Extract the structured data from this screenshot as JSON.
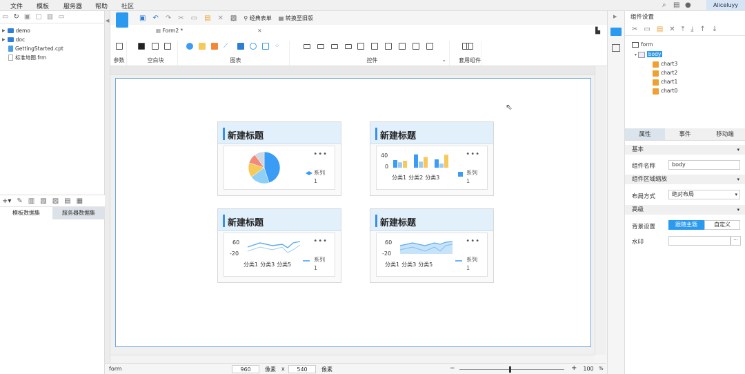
{
  "menu": {
    "file": "文件",
    "template": "模板",
    "server": "服务器",
    "help": "帮助",
    "community": "社区",
    "user": "Aliceluyy"
  },
  "left": {
    "tree": [
      {
        "label": "demo",
        "type": "folder"
      },
      {
        "label": "doc",
        "type": "folder"
      },
      {
        "label": "GettingStarted.cpt",
        "type": "file"
      },
      {
        "label": "标准地图.frm",
        "type": "map"
      }
    ],
    "ds_tab1": "模板数据集",
    "ds_tab2": "服务器数据集"
  },
  "toolbar": {
    "classic_form": "经典表单",
    "convert_old": "转换至旧版",
    "doc_tab": "Form2 *"
  },
  "ribbon": {
    "param": "参数",
    "blank_block": "空白块",
    "chart": "图表",
    "widget": "控件",
    "template_widget": "套用组件"
  },
  "cards": [
    {
      "title": "新建标题",
      "kind": "pie",
      "legend": "系列1"
    },
    {
      "title": "新建标题",
      "kind": "bar",
      "legend": "系列1",
      "ytop": "40",
      "ybottom": "0",
      "categories": [
        "分类1",
        "分类2",
        "分类3"
      ]
    },
    {
      "title": "新建标题",
      "kind": "line",
      "legend": "系列1",
      "ytop": "60",
      "ybottom": "-20",
      "categories": [
        "分类1",
        "分类3",
        "分类5"
      ]
    },
    {
      "title": "新建标题",
      "kind": "area",
      "legend": "系列1",
      "ytop": "60",
      "ybottom": "-20",
      "categories": [
        "分类1",
        "分类3",
        "分类5"
      ]
    }
  ],
  "chart_data": [
    {
      "type": "pie",
      "values": [
        45,
        20,
        15,
        10,
        10
      ],
      "colors": [
        "#3a9cf5",
        "#8ecff7",
        "#f7c85a",
        "#f28a7c",
        "#cfd8e0"
      ]
    },
    {
      "type": "bar",
      "categories": [
        "分类1",
        "分类2",
        "分类3"
      ],
      "series": [
        {
          "values": [
            20,
            35,
            22
          ]
        },
        {
          "values": [
            14,
            16,
            11
          ]
        },
        {
          "values": [
            18,
            28,
            34
          ]
        }
      ],
      "ylim": [
        0,
        40
      ]
    },
    {
      "type": "line",
      "categories": [
        "分类1",
        "分类3",
        "分类5"
      ],
      "ylim": [
        -20,
        60
      ]
    },
    {
      "type": "area",
      "categories": [
        "分类1",
        "分类3",
        "分类5"
      ],
      "ylim": [
        -20,
        60
      ]
    }
  ],
  "status": {
    "label": "form",
    "width": "960",
    "width_unit": "像素",
    "x": "x",
    "height": "540",
    "height_unit": "像素",
    "zoom": "100",
    "pct": "%"
  },
  "right": {
    "title": "组件设置",
    "tree": {
      "form": "form",
      "body": "body",
      "charts": [
        "chart3",
        "chart2",
        "chart1",
        "chart0"
      ]
    },
    "tabs": {
      "attr": "属性",
      "event": "事件",
      "mobile": "移动端"
    },
    "sections": {
      "basic": "基本",
      "scale": "组件区域缩放",
      "advanced": "高级"
    },
    "rows": {
      "name_label": "组件名称",
      "name_value": "body",
      "layout_label": "布局方式",
      "layout_value": "绝对布局",
      "bg_label": "背景设置",
      "bg_follow": "跟随主题",
      "bg_custom": "自定义",
      "watermark_label": "水印"
    }
  }
}
